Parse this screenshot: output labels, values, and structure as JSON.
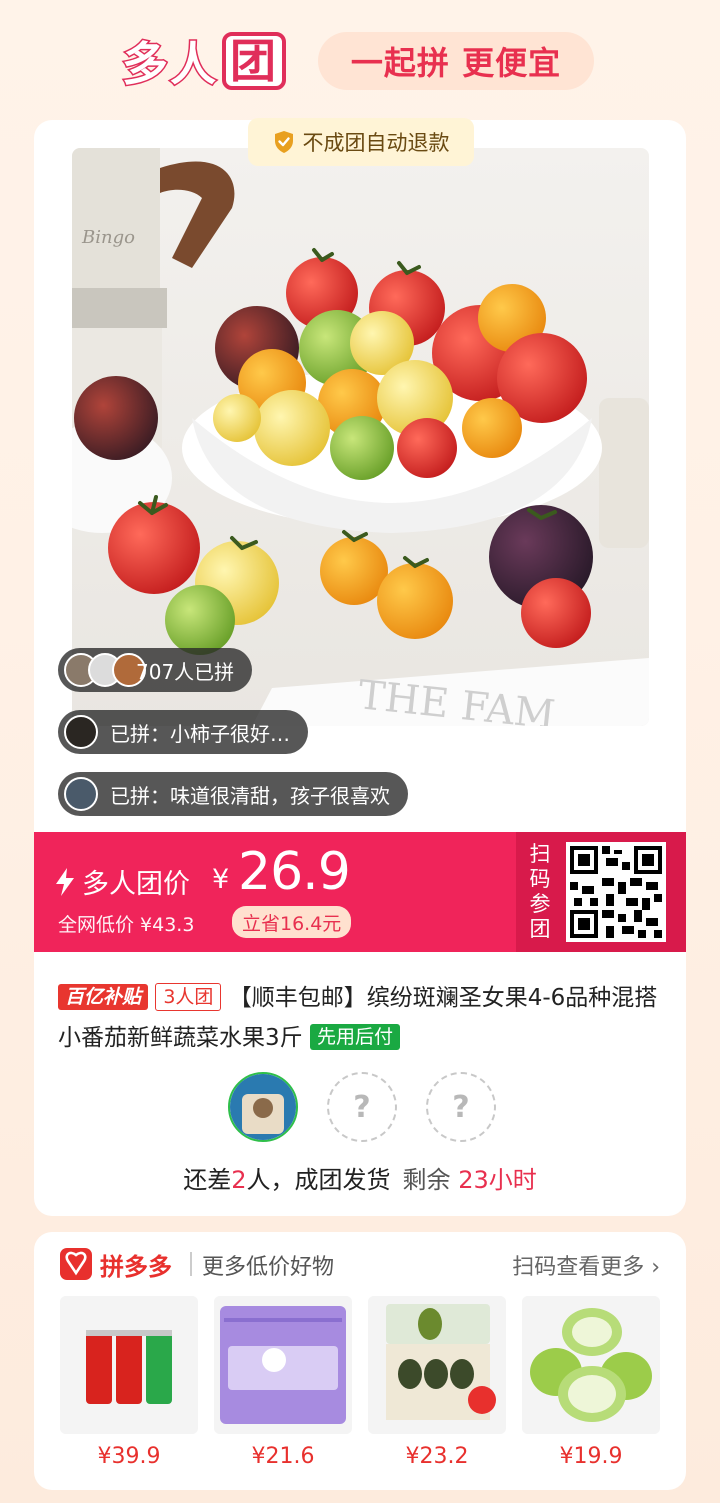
{
  "header": {
    "logo_part1": "多",
    "logo_part2": "人",
    "logo_part3": "团",
    "slogan": "一起拼 更便宜"
  },
  "refund_badge": "不成团自动退款",
  "social": {
    "count_text": "707人已拼",
    "review1": "已拼：小柿子很好…",
    "review2": "已拼：味道很清甜，孩子很喜欢"
  },
  "price": {
    "label": "多人团价",
    "currency": "¥",
    "value": "26.9",
    "orig": "全网低价 ¥43.3",
    "save": "立省16.4元",
    "scan_label": "扫码参团",
    "scan_chars": [
      "扫",
      "码",
      "参",
      "团"
    ]
  },
  "product": {
    "tag_subsidy": "百亿补贴",
    "tag_group": "3人团",
    "title": "【顺丰包邮】缤纷斑斓圣女果4-6品种混搭小番茄新鲜蔬菜水果3斤",
    "tag_pay": "先用后付"
  },
  "group": {
    "empty_slot": "?",
    "remain_prefix": "还差",
    "remain_num": "2",
    "remain_suffix": "人，成团发货",
    "time_label": "剩余",
    "time_value": "23小时"
  },
  "more": {
    "brand": "拼多多",
    "subtitle": "更多低价好物",
    "link": "扫码查看更多 ›",
    "items": [
      {
        "price": "¥39.9",
        "icon": "soda-cans"
      },
      {
        "price": "¥21.6",
        "icon": "tissue-packs"
      },
      {
        "price": "¥23.2",
        "icon": "avocado-box"
      },
      {
        "price": "¥19.9",
        "icon": "guava"
      }
    ]
  },
  "colors": {
    "brand_pink": "#f0245a",
    "accent_red": "#e8304f",
    "green": "#1aa942"
  }
}
